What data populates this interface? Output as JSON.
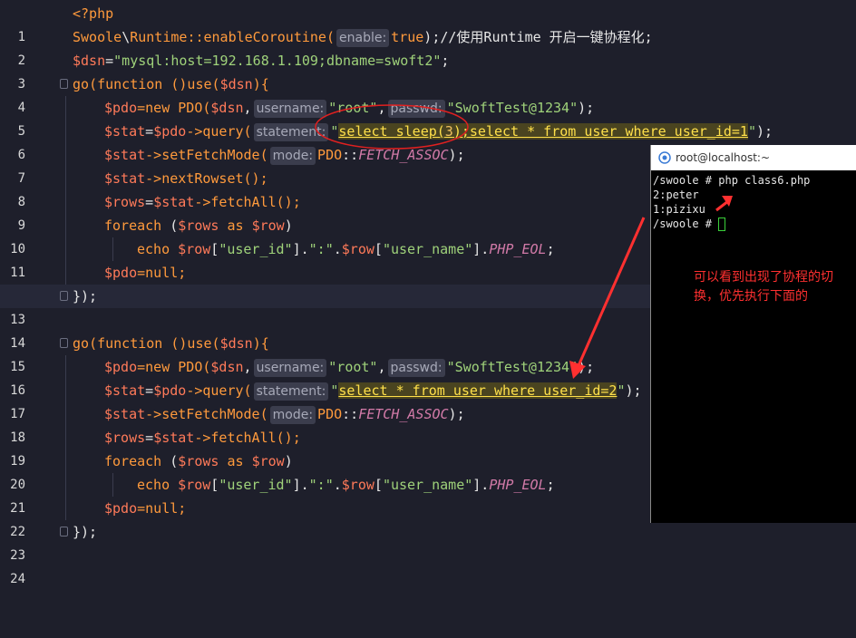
{
  "editor": {
    "hints": {
      "enable": "enable:",
      "username": "username:",
      "passwd": "passwd:",
      "statement": "statement:",
      "mode": "mode:"
    },
    "lines": [
      {
        "n": "1",
        "t": "<?php"
      },
      {
        "n": "2",
        "a": "Swoole",
        "b": "\\",
        "c": "Runtime",
        "d": "::enableCoroutine(",
        "e": "true",
        "f": ");//使用Runtime 开启一键协程化;"
      },
      {
        "n": "3",
        "a": "$dsn",
        "b": "=",
        "c": "\"mysql:host=192.168.1.109;dbname=swoft2\"",
        "d": ";"
      },
      {
        "n": "4",
        "a": "go",
        "b": "(function ()use(",
        "c": "$dsn",
        "d": "){"
      },
      {
        "n": "5",
        "a": "$pdo",
        "b": "=new PDO(",
        "c": "$dsn",
        "d": ",",
        "e": "\"root\"",
        "f": ",",
        "g": "\"SwoftTest@1234\"",
        "h": ");"
      },
      {
        "n": "6",
        "a": "$stat",
        "b": "=",
        "c": "$pdo",
        "d": "->query(",
        "e": "\"",
        "f1": "select sleep(",
        "f2": "3",
        "f3": ");select * from user where user_id=1",
        "g": "\"",
        "h": ");"
      },
      {
        "n": "7",
        "a": "$stat",
        "b": "->setFetchMode(",
        "c": "PDO",
        "d": "::",
        "e": "FETCH_ASSOC",
        "f": ");"
      },
      {
        "n": "8",
        "a": "$stat",
        "b": "->nextRowset();"
      },
      {
        "n": "9",
        "a": "$rows",
        "b": "=",
        "c": "$stat",
        "d": "->fetchAll();"
      },
      {
        "n": "10",
        "a": "foreach",
        "b": " (",
        "c": "$rows",
        "d": " as ",
        "e": "$row",
        "f": ")"
      },
      {
        "n": "11",
        "a": "echo ",
        "b": "$row",
        "c": "[",
        "d": "\"user_id\"",
        "e": "].",
        "f": "\":\"",
        "g": ".",
        "h": "$row",
        "i": "[",
        "j": "\"user_name\"",
        "k": "].",
        "l": "PHP_EOL",
        "m": ";"
      },
      {
        "n": "12",
        "a": "$pdo",
        "b": "=null;"
      },
      {
        "n": "13",
        "t": "});"
      },
      {
        "n": "14",
        "t": ""
      },
      {
        "n": "15",
        "a": "go",
        "b": "(function ()use(",
        "c": "$dsn",
        "d": "){"
      },
      {
        "n": "16",
        "a": "$pdo",
        "b": "=new PDO(",
        "c": "$dsn",
        "d": ",",
        "e": "\"root\"",
        "f": ",",
        "g": "\"SwoftTest@1234\"",
        "h": ");"
      },
      {
        "n": "17",
        "a": "$stat",
        "b": "=",
        "c": "$pdo",
        "d": "->query(",
        "e": "\"",
        "f1": "select * from user where user_id=2",
        "g": "\"",
        "h": ");"
      },
      {
        "n": "18",
        "a": "$stat",
        "b": "->setFetchMode(",
        "c": "PDO",
        "d": "::",
        "e": "FETCH_ASSOC",
        "f": ");"
      },
      {
        "n": "19",
        "a": "$rows",
        "b": "=",
        "c": "$stat",
        "d": "->fetchAll();"
      },
      {
        "n": "20",
        "a": "foreach",
        "b": " (",
        "c": "$rows",
        "d": " as ",
        "e": "$row",
        "f": ")"
      },
      {
        "n": "21",
        "a": "echo ",
        "b": "$row",
        "c": "[",
        "d": "\"user_id\"",
        "e": "].",
        "f": "\":\"",
        "g": ".",
        "h": "$row",
        "i": "[",
        "j": "\"user_name\"",
        "k": "].",
        "l": "PHP_EOL",
        "m": ";"
      },
      {
        "n": "22",
        "a": "$pdo",
        "b": "=null;"
      },
      {
        "n": "23",
        "t": "});"
      },
      {
        "n": "24",
        "t": ""
      }
    ]
  },
  "terminal": {
    "title": "root@localhost:~",
    "lines": [
      "/swoole # php class6.php",
      "2:peter",
      "1:pizixu",
      "/swoole # "
    ]
  },
  "annotation": {
    "note": "可以看到出现了协程的切换，优先执行下面的"
  },
  "colors": {
    "background": "#1e1f2b",
    "keyword": "#ff9a3c",
    "variable": "#ff7a59",
    "string": "#9fd27a",
    "sql_highlight": "#ffe04a",
    "annotation": "#ff3030"
  }
}
